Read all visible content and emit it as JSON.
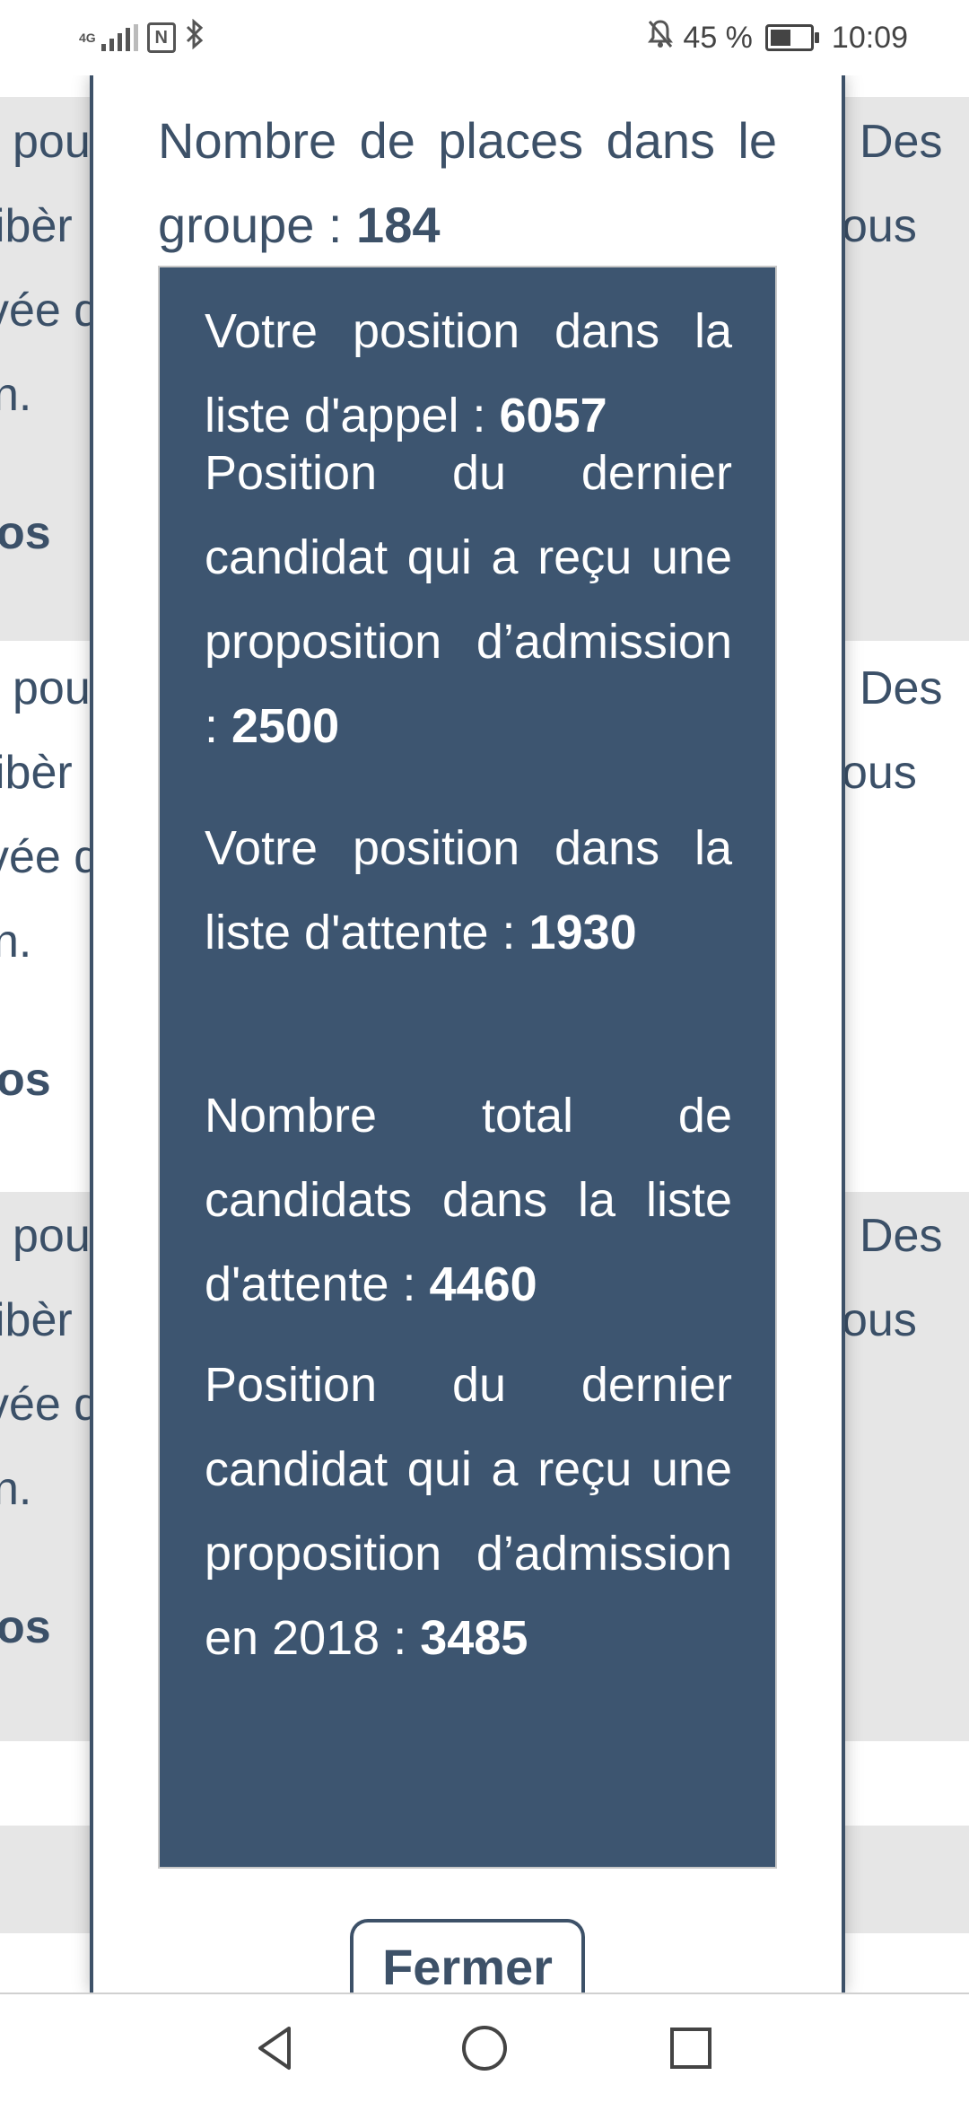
{
  "status_bar": {
    "network": "4G",
    "nfc": "N",
    "battery_percent": "45 %",
    "time": "10:09",
    "battery_level": 0.45,
    "icons": [
      "signal-icon",
      "nfc-icon",
      "bluetooth-icon",
      "mute-bell-icon",
      "battery-icon"
    ]
  },
  "background_rows": [
    {
      "left_lines": [
        "pou",
        "ibèr",
        "vée d",
        "n."
      ],
      "right_lines": [
        "Des",
        "ous"
      ],
      "bold": "os"
    },
    {
      "left_lines": [
        "pou",
        "ibèr",
        "vée d",
        "n."
      ],
      "right_lines": [
        "Des",
        "ous"
      ],
      "bold": "os"
    },
    {
      "left_lines": [
        "pou",
        "ibèr",
        "vée d",
        "n."
      ],
      "right_lines": [
        "Des",
        "ous"
      ],
      "bold": "os"
    }
  ],
  "modal": {
    "places_label": "Nombre de places dans le groupe : ",
    "places_value": "184",
    "items": [
      {
        "label": "Votre position dans la liste d'appel : ",
        "value": "6057"
      },
      {
        "label": "Position du dernier candidat qui a reçu une proposition d’admission : ",
        "value": "2500"
      },
      {
        "label": "Votre position dans la liste d'attente : ",
        "value": "1930"
      },
      {
        "label": "Nombre total de candidats dans la liste d'attente : ",
        "value": "4460"
      },
      {
        "label": "Position du dernier candidat qui a reçu une proposition d’admission en 2018 : ",
        "value": "3485"
      }
    ],
    "close_label": "Fermer"
  },
  "nav": {
    "icons": [
      "back-icon",
      "home-icon",
      "recents-icon"
    ]
  },
  "colors": {
    "panel": "#3d5570",
    "text_dark": "#3d5168",
    "background_stripe": "#e6e6e6"
  }
}
